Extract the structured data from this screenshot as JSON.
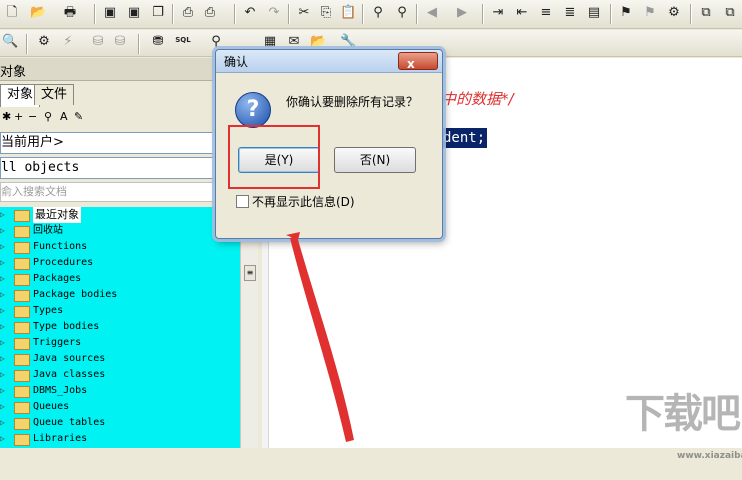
{
  "toolbar_top": {
    "icons": [
      "new-icon",
      "open-icon",
      "print-icon",
      "save-icon",
      "save-all-icon",
      "copy-window-icon",
      "print-preview-icon",
      "printer-icon",
      "undo-icon",
      "redo-icon",
      "cut-icon",
      "copy-icon",
      "paste-icon",
      "find-icon",
      "find-next-icon",
      "indent-icon",
      "unindent-icon",
      "uppercase-icon",
      "lowercase-icon",
      "comment-icon",
      "uncomment-icon",
      "window-icon",
      "cascade-icon"
    ]
  },
  "toolbar_second": {
    "sql_label": "SQL"
  },
  "left_panel": {
    "title": "对象",
    "tabs": [
      {
        "label": "对象",
        "active": true
      },
      {
        "label": "文件",
        "active": false
      }
    ],
    "mini_toolbar": [
      "+",
      "−",
      "*",
      "A",
      "✎"
    ],
    "owner_combo": "当前用户>",
    "object_filter": "ll objects",
    "search_placeholder": "俞入搜索文档",
    "tree_items": [
      {
        "label": "最近对象",
        "selected": true
      },
      {
        "label": "回收站"
      },
      {
        "label": "Functions"
      },
      {
        "label": "Procedures"
      },
      {
        "label": "Packages"
      },
      {
        "label": "Package bodies"
      },
      {
        "label": "Types"
      },
      {
        "label": "Type bodies"
      },
      {
        "label": "Triggers"
      },
      {
        "label": "Java sources"
      },
      {
        "label": "Java classes"
      },
      {
        "label": "DBMS_Jobs"
      },
      {
        "label": "Queues"
      },
      {
        "label": "Queue tables"
      },
      {
        "label": "Libraries"
      }
    ]
  },
  "editor": {
    "comment_fragment": "中的数据*/",
    "code_fragment": "dent;"
  },
  "dialog": {
    "title": "确认",
    "close_glyph": "x",
    "message": "你确认要删除所有记录？",
    "yes_button": "是(Y)",
    "no_button": "否(N)",
    "checkbox_label": "不再显示此信息(D)",
    "checkbox_checked": false
  },
  "watermark": {
    "text": "下载吧",
    "sub": "www.xiazaiba.com"
  },
  "colors": {
    "tree_bg": "#00f2f2",
    "highlight": "#e03030",
    "selection": "#0a246a"
  }
}
